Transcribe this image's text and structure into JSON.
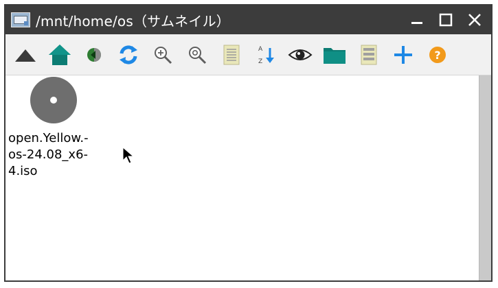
{
  "window": {
    "title": "/mnt/home/os（サムネイル）",
    "controls": [
      "minimize",
      "maximize",
      "close"
    ]
  },
  "toolbar": {
    "buttons": [
      {
        "name": "up",
        "icon": "up-arrow-icon"
      },
      {
        "name": "home",
        "icon": "home-icon"
      },
      {
        "name": "back",
        "icon": "back-icon"
      },
      {
        "name": "refresh",
        "icon": "refresh-icon"
      },
      {
        "name": "zoom-in",
        "icon": "zoom-in-icon"
      },
      {
        "name": "zoom-out",
        "icon": "zoom-out-icon"
      },
      {
        "name": "list-view",
        "icon": "list-view-icon"
      },
      {
        "name": "sort",
        "icon": "sort-icon"
      },
      {
        "name": "show-hidden",
        "icon": "eye-icon"
      },
      {
        "name": "folder",
        "icon": "folder-icon"
      },
      {
        "name": "details-view",
        "icon": "details-view-icon"
      },
      {
        "name": "new",
        "icon": "plus-icon"
      },
      {
        "name": "help",
        "icon": "help-icon"
      }
    ]
  },
  "files": [
    {
      "label_lines": [
        "open.Yellow.-",
        "os-24.08_x6-",
        "4.iso"
      ],
      "icon": "disc-image-icon"
    }
  ],
  "colors": {
    "titlebar": "#3c3c3c",
    "toolbar": "#f1f1f1",
    "teal": "#0c7c73",
    "blue": "#1e88e5",
    "orange": "#f29a1b"
  }
}
